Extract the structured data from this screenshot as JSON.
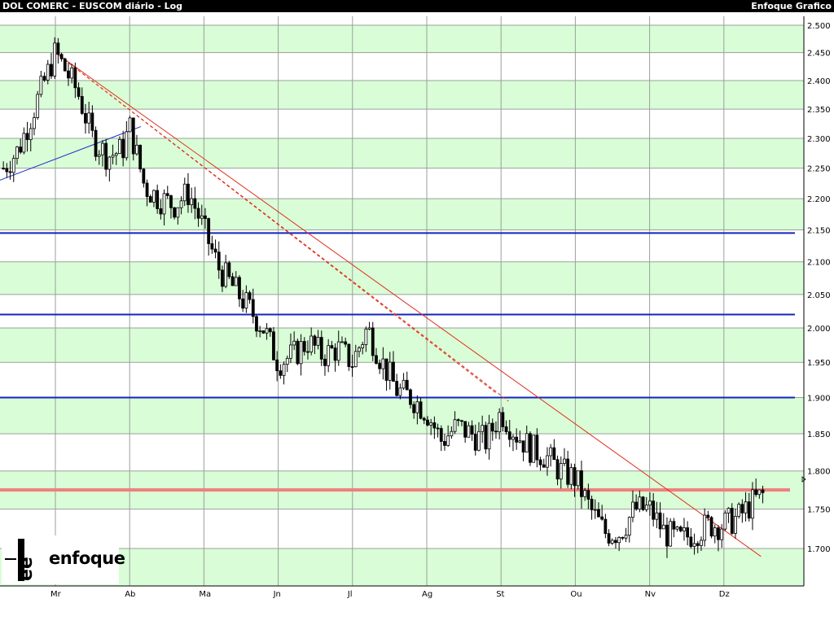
{
  "header": {
    "title_left": "DOL COMERC - EUSCOM diário - Log",
    "title_right": "Enfoque Grafico"
  },
  "logo": {
    "text": "enfoque"
  },
  "colors": {
    "band": "#d9fdd7",
    "grid": "#9aa09a",
    "candle": "#000000",
    "trendline": "#e0301c",
    "level_line": "#1326b8",
    "resistance": "#f08080",
    "support_line": "#1b2dc4"
  },
  "chart_data": {
    "type": "candlestick",
    "title": "DOL COMERC - EUSCOM diário - Log",
    "y_scale": "log",
    "ylim": [
      1.655,
      2.52
    ],
    "y_ticks": [
      "2.500",
      "2.450",
      "2.400",
      "2.350",
      "2.300",
      "2.250",
      "2.200",
      "2.150",
      "2.100",
      "2.050",
      "2.000",
      "1.950",
      "1.900",
      "1.850",
      "1.800",
      "1.750",
      "1.700"
    ],
    "x_ticks": [
      "Mr",
      "Ab",
      "Ma",
      "Jn",
      "Jl",
      "Ag",
      "St",
      "Ou",
      "Nv",
      "Dz"
    ],
    "grid": true,
    "horizontal_levels": [
      {
        "value": 2.145,
        "style": "blue"
      },
      {
        "value": 2.02,
        "style": "blue"
      },
      {
        "value": 1.9,
        "style": "blue"
      },
      {
        "value": 1.775,
        "style": "red-thick"
      }
    ],
    "trendlines": [
      {
        "from": [
          0.0,
          2.45
        ],
        "to": [
          9.5,
          1.69
        ],
        "style": "solid-red"
      },
      {
        "from": [
          0.0,
          2.45
        ],
        "to": [
          6.1,
          1.895
        ],
        "style": "dashed-red"
      },
      {
        "from": [
          0.0,
          2.45
        ],
        "to": [
          5.95,
          1.905
        ],
        "style": "dashed-red"
      },
      {
        "from": [
          -0.75,
          2.23
        ],
        "to": [
          1.15,
          2.32
        ],
        "style": "solid-blue"
      }
    ],
    "ohlc_keypoints": [
      [
        -0.7,
        2.25
      ],
      [
        -0.5,
        2.28
      ],
      [
        -0.2,
        2.38
      ],
      [
        0.0,
        2.45
      ],
      [
        0.3,
        2.38
      ],
      [
        0.5,
        2.3
      ],
      [
        0.7,
        2.27
      ],
      [
        0.9,
        2.28
      ],
      [
        1.0,
        2.32
      ],
      [
        1.2,
        2.22
      ],
      [
        1.4,
        2.2
      ],
      [
        1.6,
        2.19
      ],
      [
        1.8,
        2.21
      ],
      [
        2.0,
        2.15
      ],
      [
        2.2,
        2.09
      ],
      [
        2.4,
        2.06
      ],
      [
        2.6,
        2.03
      ],
      [
        2.8,
        2.0
      ],
      [
        3.0,
        1.95
      ],
      [
        3.2,
        1.96
      ],
      [
        3.4,
        1.98
      ],
      [
        3.6,
        1.96
      ],
      [
        3.8,
        1.97
      ],
      [
        4.0,
        1.95
      ],
      [
        4.2,
        2.0
      ],
      [
        4.4,
        1.95
      ],
      [
        4.6,
        1.91
      ],
      [
        4.8,
        1.9
      ],
      [
        5.0,
        1.88
      ],
      [
        5.2,
        1.84
      ],
      [
        5.4,
        1.86
      ],
      [
        5.6,
        1.85
      ],
      [
        5.8,
        1.84
      ],
      [
        6.0,
        1.88
      ],
      [
        6.2,
        1.85
      ],
      [
        6.4,
        1.83
      ],
      [
        6.6,
        1.82
      ],
      [
        6.8,
        1.8
      ],
      [
        7.0,
        1.79
      ],
      [
        7.2,
        1.75
      ],
      [
        7.4,
        1.72
      ],
      [
        7.6,
        1.72
      ],
      [
        7.8,
        1.75
      ],
      [
        8.0,
        1.75
      ],
      [
        8.2,
        1.72
      ],
      [
        8.4,
        1.71
      ],
      [
        8.6,
        1.72
      ],
      [
        8.8,
        1.73
      ],
      [
        9.0,
        1.73
      ],
      [
        9.2,
        1.74
      ],
      [
        9.4,
        1.76
      ],
      [
        9.55,
        1.77
      ]
    ]
  }
}
